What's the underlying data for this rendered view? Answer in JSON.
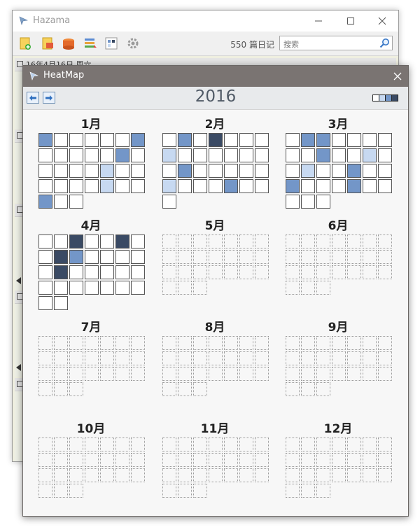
{
  "main_window": {
    "title": "Hazama",
    "diary_count": "550 篇日记",
    "search_placeholder": "搜索",
    "entry_date": "16年4月16日 周六",
    "toolbar_icons": [
      "new-entry-icon",
      "export-icon",
      "backup-icon",
      "tags-icon",
      "heatmap-icon",
      "settings-icon"
    ]
  },
  "heatmap": {
    "title": "HeatMap",
    "year": "2016",
    "legend_colors": [
      "#ffffff",
      "#c7d9f1",
      "#7396c8",
      "#3a4a64"
    ],
    "months": [
      {
        "label": "1月",
        "start": 0,
        "days": 31,
        "active": true,
        "levels": {
          "1": 2,
          "7": 2,
          "13": 2,
          "19": 1,
          "26": 1,
          "29": 2
        }
      },
      {
        "label": "2月",
        "start": 0,
        "days": 29,
        "active": true,
        "levels": {
          "2": 2,
          "4": 3,
          "8": 1,
          "16": 2,
          "22": 1,
          "26": 2
        }
      },
      {
        "label": "3月",
        "start": 0,
        "days": 31,
        "active": true,
        "levels": {
          "2": 2,
          "3": 2,
          "10": 2,
          "13": 1,
          "16": 1,
          "19": 2,
          "22": 2,
          "26": 2
        }
      },
      {
        "label": "4月",
        "start": 0,
        "days": 30,
        "active": true,
        "levels": {
          "3": 3,
          "6": 3,
          "9": 3,
          "10": 2,
          "16": 3
        }
      },
      {
        "label": "5月",
        "start": 0,
        "days": 24,
        "active": false
      },
      {
        "label": "6月",
        "start": 0,
        "days": 24,
        "active": false
      },
      {
        "label": "7月",
        "start": 0,
        "days": 24,
        "active": false
      },
      {
        "label": "8月",
        "start": 0,
        "days": 24,
        "active": false
      },
      {
        "label": "9月",
        "start": 0,
        "days": 24,
        "active": false
      },
      {
        "label": "10月",
        "start": 0,
        "days": 24,
        "active": false
      },
      {
        "label": "11月",
        "start": 0,
        "days": 24,
        "active": false
      },
      {
        "label": "12月",
        "start": 0,
        "days": 24,
        "active": false
      }
    ]
  }
}
